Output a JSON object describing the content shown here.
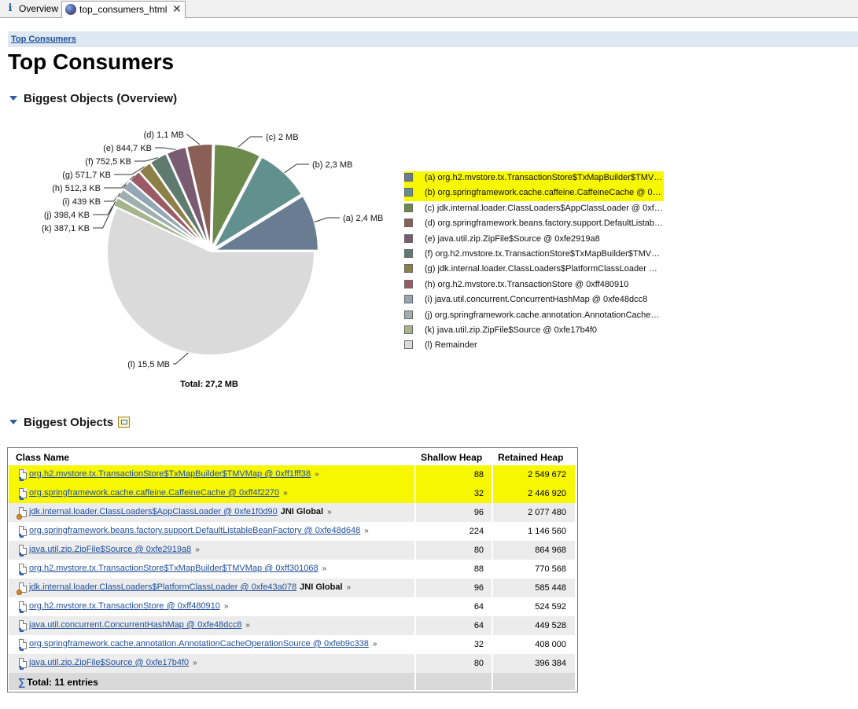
{
  "tabs": [
    {
      "label": "Overview",
      "icon": "info-icon"
    },
    {
      "label": "top_consumers_html",
      "icon": "globe-icon",
      "closable": true
    }
  ],
  "breadcrumb": "Top Consumers",
  "page_title": "Top Consumers",
  "sections": {
    "overview_title": "Biggest Objects (Overview)",
    "table_title": "Biggest Objects"
  },
  "chart_data": {
    "type": "pie",
    "title": "",
    "total_label": "Total: 27,2 MB",
    "slices": [
      {
        "key": "a",
        "label": "(a)  2,4 MB",
        "value": 2.4,
        "color": "#687d91",
        "legend": "org.h2.mvstore.tx.TransactionStore$TxMapBuilder$TMVMap @ 0xff1fff38",
        "highlighted": true
      },
      {
        "key": "b",
        "label": "(b)  2,3 MB",
        "value": 2.3,
        "color": "#62908e",
        "legend": "org.springframework.cache.caffeine.CaffeineCache @ 0xff4f2270",
        "highlighted": true
      },
      {
        "key": "c",
        "label": "(c)  2 MB",
        "value": 2.0,
        "color": "#6c8a4b",
        "legend": "jdk.internal.loader.ClassLoaders$AppClassLoader @ 0xfe1f0d90",
        "highlighted": false
      },
      {
        "key": "d",
        "label": "(d)  1,1 MB",
        "value": 1.1,
        "color": "#8a5f56",
        "legend": "org.springframework.beans.factory.support.DefaultListableBeanFactory @ 0xfe48d648",
        "highlighted": false
      },
      {
        "key": "e",
        "label": "(e)  844,7 KB",
        "value": 0.8447,
        "color": "#7a5c72",
        "legend": "java.util.zip.ZipFile$Source @ 0xfe2919a8",
        "highlighted": false
      },
      {
        "key": "f",
        "label": "(f)  752,5 KB",
        "value": 0.7525,
        "color": "#5f7a6e",
        "legend": "org.h2.mvstore.tx.TransactionStore$TxMapBuilder$TMVMap @ 0xff301068",
        "highlighted": false
      },
      {
        "key": "g",
        "label": "(g)  571,7 KB",
        "value": 0.5717,
        "color": "#8c7f48",
        "legend": "jdk.internal.loader.ClassLoaders$PlatformClassLoader @ 0xfe43a078",
        "highlighted": false
      },
      {
        "key": "h",
        "label": "(h)  512,3 KB",
        "value": 0.5123,
        "color": "#9a5a66",
        "legend": "org.h2.mvstore.tx.TransactionStore @ 0xff480910",
        "highlighted": false
      },
      {
        "key": "i",
        "label": "(i)  439 KB",
        "value": 0.439,
        "color": "#95a6b4",
        "legend": "java.util.concurrent.ConcurrentHashMap @ 0xfe48dcc8",
        "highlighted": false
      },
      {
        "key": "j",
        "label": "(j)  398,4 KB",
        "value": 0.3984,
        "color": "#9eb0ae",
        "legend": "org.springframework.cache.annotation.AnnotationCacheOperationSource @ 0xfeb9c338",
        "highlighted": false
      },
      {
        "key": "k",
        "label": "(k)  387,1 KB",
        "value": 0.3871,
        "color": "#a6b48e",
        "legend": "java.util.zip.ZipFile$Source @ 0xfe17b4f0",
        "highlighted": false
      },
      {
        "key": "l",
        "label": "(l)  15,5 MB",
        "value": 15.5,
        "color": "#dadada",
        "legend": "Remainder",
        "highlighted": false
      }
    ]
  },
  "table": {
    "columns": [
      "Class Name",
      "Shallow Heap",
      "Retained Heap"
    ],
    "rows": [
      {
        "name": "org.h2.mvstore.tx.TransactionStore$TxMapBuilder$TMVMap @ 0xff1fff38",
        "suffix": "",
        "shallow": "88",
        "retained": "2 549 672",
        "gc_root": false,
        "highlighted": true
      },
      {
        "name": "org.springframework.cache.caffeine.CaffeineCache @ 0xff4f2270",
        "suffix": "",
        "shallow": "32",
        "retained": "2 446 920",
        "gc_root": false,
        "highlighted": true
      },
      {
        "name": "jdk.internal.loader.ClassLoaders$AppClassLoader @ 0xfe1f0d90",
        "suffix": "JNI Global",
        "shallow": "96",
        "retained": "2 077 480",
        "gc_root": true,
        "highlighted": false
      },
      {
        "name": "org.springframework.beans.factory.support.DefaultListableBeanFactory @ 0xfe48d648",
        "suffix": "",
        "shallow": "224",
        "retained": "1 146 560",
        "gc_root": false,
        "highlighted": false
      },
      {
        "name": "java.util.zip.ZipFile$Source @ 0xfe2919a8",
        "suffix": "",
        "shallow": "80",
        "retained": "864 968",
        "gc_root": false,
        "highlighted": false
      },
      {
        "name": "org.h2.mvstore.tx.TransactionStore$TxMapBuilder$TMVMap @ 0xff301068",
        "suffix": "",
        "shallow": "88",
        "retained": "770 568",
        "gc_root": false,
        "highlighted": false
      },
      {
        "name": "jdk.internal.loader.ClassLoaders$PlatformClassLoader @ 0xfe43a078",
        "suffix": "JNI Global",
        "shallow": "96",
        "retained": "585 448",
        "gc_root": true,
        "highlighted": false
      },
      {
        "name": "org.h2.mvstore.tx.TransactionStore @ 0xff480910",
        "suffix": "",
        "shallow": "64",
        "retained": "524 592",
        "gc_root": false,
        "highlighted": false
      },
      {
        "name": "java.util.concurrent.ConcurrentHashMap @ 0xfe48dcc8",
        "suffix": "",
        "shallow": "64",
        "retained": "449 528",
        "gc_root": false,
        "highlighted": false
      },
      {
        "name": "org.springframework.cache.annotation.AnnotationCacheOperationSource @ 0xfeb9c338",
        "suffix": "",
        "shallow": "32",
        "retained": "408 000",
        "gc_root": false,
        "highlighted": false
      },
      {
        "name": "java.util.zip.ZipFile$Source @ 0xfe17b4f0",
        "suffix": "",
        "shallow": "80",
        "retained": "396 384",
        "gc_root": false,
        "highlighted": false
      }
    ],
    "more_symbol": "»",
    "total": "Total: 11 entries",
    "total_symbol": "∑"
  },
  "colors": {
    "highlight": "#f7f700",
    "link": "#1f4e9c",
    "crumb_bg": "#dde8f3"
  }
}
